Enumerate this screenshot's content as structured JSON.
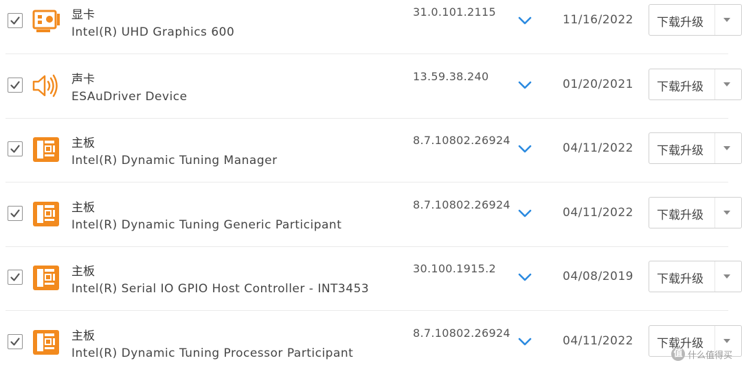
{
  "colors": {
    "accent_orange": "#F28A1E",
    "chevron_blue": "#2B8AE0",
    "checkbox_border": "#8F8F8F",
    "divider": "#EAEAEA"
  },
  "drivers": [
    {
      "checked": true,
      "icon": "graphics-card-icon",
      "category": "显卡",
      "name": "Intel(R) UHD Graphics 600",
      "version": "31.0.101.2115",
      "date": "11/16/2022",
      "action": "下载升级"
    },
    {
      "checked": true,
      "icon": "speaker-icon",
      "category": "声卡",
      "name": "ESAuDriver Device",
      "version": "13.59.38.240",
      "date": "01/20/2021",
      "action": "下载升级"
    },
    {
      "checked": true,
      "icon": "motherboard-icon",
      "category": "主板",
      "name": "Intel(R) Dynamic Tuning Manager",
      "version": "8.7.10802.26924",
      "date": "04/11/2022",
      "action": "下载升级"
    },
    {
      "checked": true,
      "icon": "motherboard-icon",
      "category": "主板",
      "name": "Intel(R) Dynamic Tuning Generic Participant",
      "version": "8.7.10802.26924",
      "date": "04/11/2022",
      "action": "下载升级"
    },
    {
      "checked": true,
      "icon": "motherboard-icon",
      "category": "主板",
      "name": "Intel(R) Serial IO GPIO Host Controller - INT3453",
      "version": "30.100.1915.2",
      "date": "04/08/2019",
      "action": "下载升级"
    },
    {
      "checked": true,
      "icon": "motherboard-icon",
      "category": "主板",
      "name": "Intel(R) Dynamic Tuning Processor Participant",
      "version": "8.7.10802.26924",
      "date": "04/11/2022",
      "action": "下载升级"
    }
  ],
  "watermark": {
    "badge": "值",
    "text": "什么值得买"
  }
}
